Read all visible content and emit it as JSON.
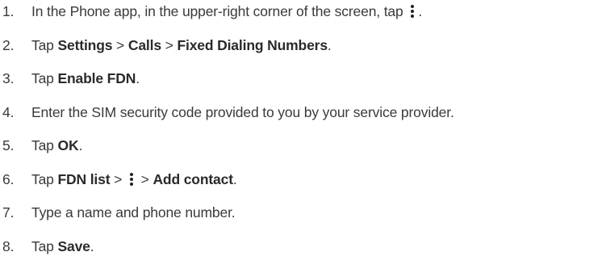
{
  "steps": [
    {
      "num": "1.",
      "text_a": "In the Phone app, in the upper-right corner of the screen, tap",
      "icon": "more-options-icon",
      "text_b": "."
    },
    {
      "num": "2.",
      "text_a": "Tap",
      "b1": "Settings",
      "sep1": ">",
      "b2": "Calls",
      "sep2": ">",
      "b3": "Fixed Dialing Numbers",
      "end": "."
    },
    {
      "num": "3.",
      "text_a": "Tap",
      "b1": "Enable FDN",
      "end": "."
    },
    {
      "num": "4.",
      "text_a": "Enter the SIM security code provided to you by your service provider."
    },
    {
      "num": "5.",
      "text_a": "Tap",
      "b1": "OK",
      "end": "."
    },
    {
      "num": "6.",
      "text_a": "Tap",
      "b1": "FDN list",
      "sep1": ">",
      "icon": "more-options-icon",
      "sep2": ">",
      "b2": "Add contact",
      "end": "."
    },
    {
      "num": "7.",
      "text_a": "Type a name and phone number."
    },
    {
      "num": "8.",
      "text_a": "Tap",
      "b1": "Save",
      "end": "."
    }
  ]
}
